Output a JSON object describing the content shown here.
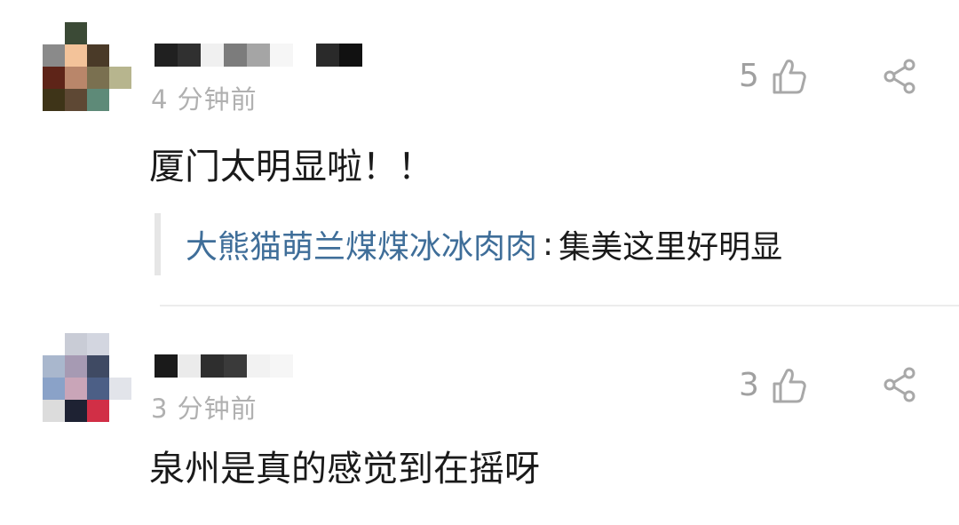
{
  "comments": [
    {
      "time": "4 分钟前",
      "likes": "5",
      "text": "厦门太明显啦！！",
      "reply": {
        "author": "大熊猫萌兰煤煤冰冰肉肉",
        "separator": ":",
        "text": "集美这里好明显"
      },
      "like_icon": "thumbs-up-icon",
      "share_icon": "share-icon",
      "avatar_note": "pixelated avatar"
    },
    {
      "time": "3 分钟前",
      "likes": "3",
      "text": "泉州是真的感觉到在摇呀",
      "like_icon": "thumbs-up-icon",
      "share_icon": "share-icon",
      "avatar_note": "pixelated avatar"
    }
  ],
  "colors": {
    "time": "#b0b0b0",
    "reply_author": "#3f6e99",
    "icon": "#a8a8a8",
    "text": "#1a1a1a"
  }
}
